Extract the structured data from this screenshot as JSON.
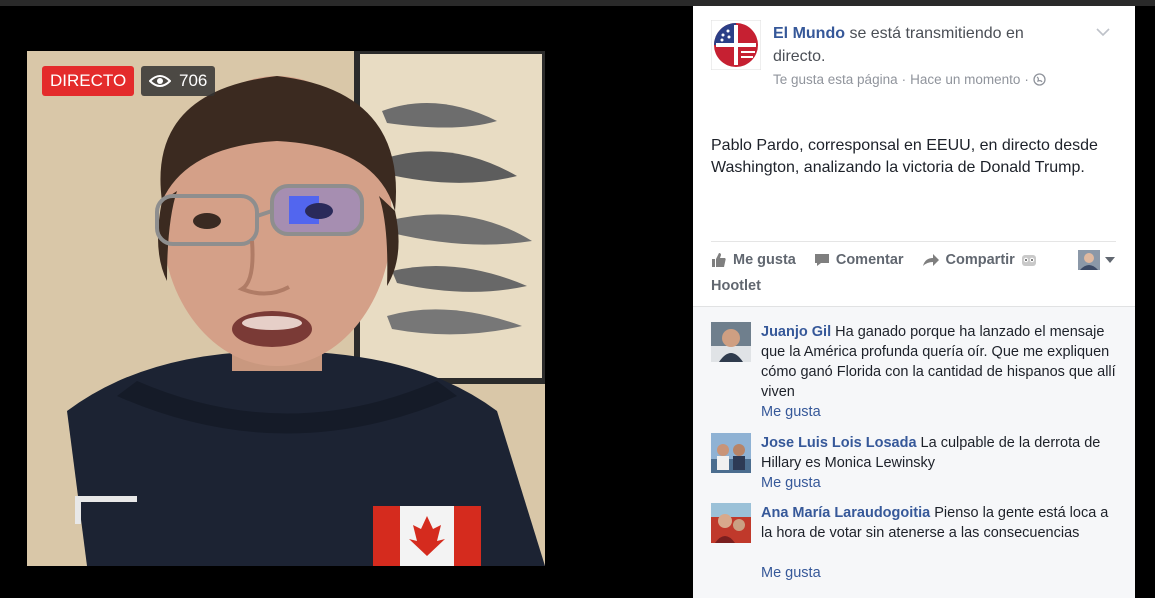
{
  "video": {
    "live_badge": "DIRECTO",
    "view_count": "706",
    "eye_icon": "eye-icon"
  },
  "post": {
    "page_name": "El Mundo",
    "header_suffix": "se está transmitiendo en directo.",
    "meta_like": "Te gusta esta página",
    "meta_sep": "·",
    "meta_time": "Hace un momento",
    "meta_sep2": "·",
    "audience_icon": "globe-icon",
    "text": "Pablo Pardo, corresponsal en EEUU, en directo desde Washington, analizando la victoria de Donald Trump."
  },
  "actions": {
    "like": "Me gusta",
    "comment": "Comentar",
    "share": "Compartir",
    "hootlet": "Hootlet"
  },
  "comments": [
    {
      "name": "Juanjo Gil",
      "text": "Ha ganado porque ha lanzado el mensaje que la América profunda quería oír. Que me expliquen cómo ganó Florida con la cantidad de hispanos que allí viven",
      "like": "Me gusta"
    },
    {
      "name": "Jose Luis Lois Losada",
      "text": "La culpable de la derrota de Hillary es Monica Lewinsky",
      "like": "Me gusta"
    },
    {
      "name": "Ana María Laraudogoitia",
      "text": "Pienso la gente está loca a la hora de votar sin atenerse a las consecuencias",
      "like": "Me gusta"
    }
  ],
  "colors": {
    "live_red": "#e42b2b",
    "fb_blue": "#365899",
    "panel_bg": "#ffffff",
    "comments_bg": "#f6f7f9"
  }
}
